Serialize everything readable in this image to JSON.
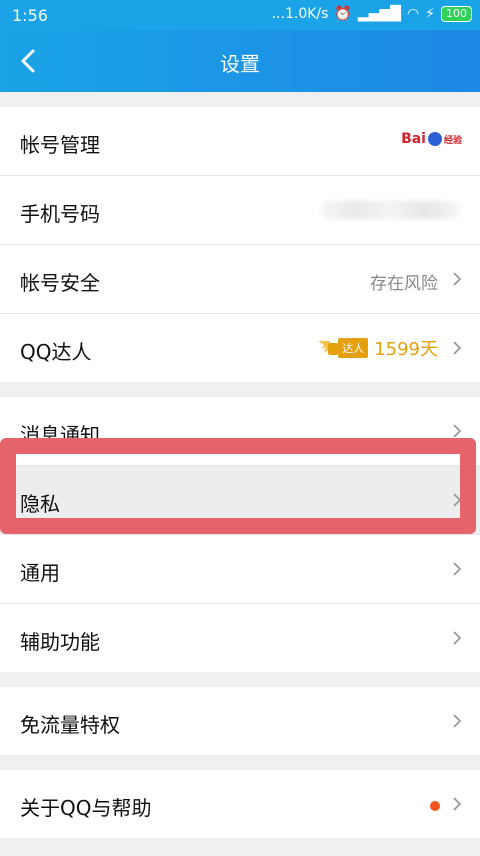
{
  "status": {
    "time": "1:56",
    "speed": "...1.0K/s",
    "battery": "100"
  },
  "header": {
    "title": "设置"
  },
  "section1": [
    {
      "label": "帐号管理",
      "right": "baidu"
    },
    {
      "label": "手机号码",
      "right": "blurred"
    },
    {
      "label": "帐号安全",
      "value": "存在风险"
    },
    {
      "label": "QQ达人",
      "badge": "达人",
      "days": "1599天"
    }
  ],
  "section2": [
    {
      "label": "消息通知"
    },
    {
      "label": "隐私"
    },
    {
      "label": "通用"
    },
    {
      "label": "辅助功能"
    }
  ],
  "section3": [
    {
      "label": "免流量特权"
    }
  ],
  "section4": [
    {
      "label": "关于QQ与帮助",
      "notification_dot": true
    }
  ],
  "baidu_logo": {
    "text": "Bai",
    "sub": "经验"
  },
  "colors": {
    "header": "#1aa3e6",
    "highlight": "#e5646b",
    "dot": "#f2541e",
    "gold": "#e5a00d"
  }
}
